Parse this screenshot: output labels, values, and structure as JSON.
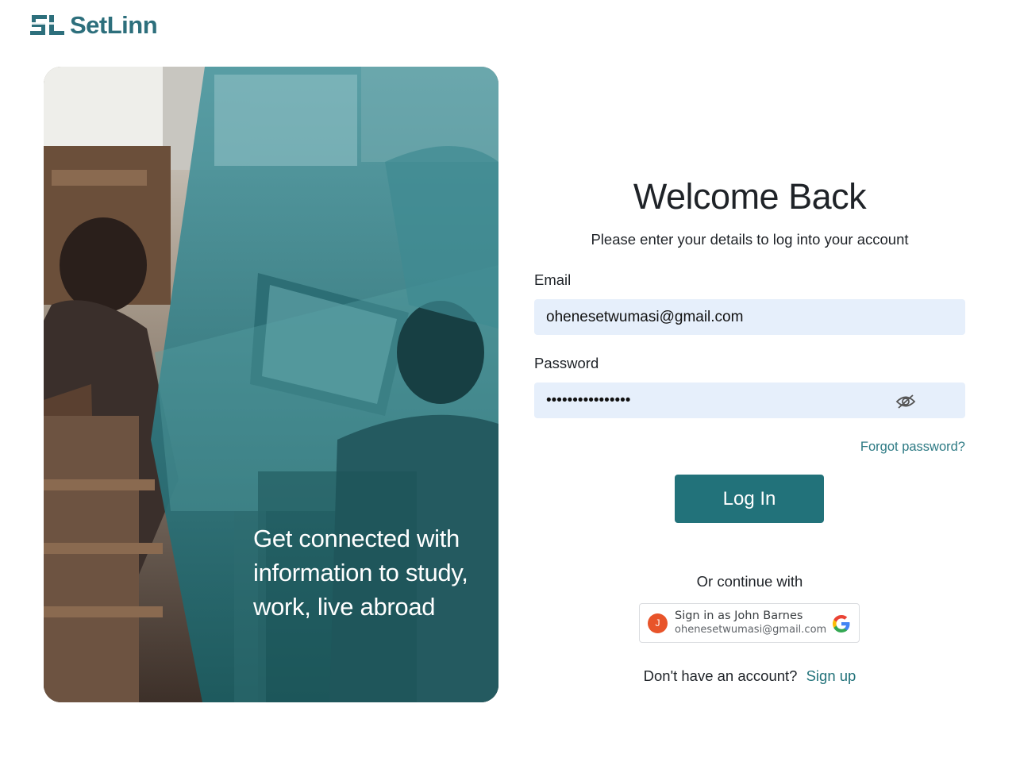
{
  "brand": {
    "name": "SetLinn",
    "color": "#2d6f7c"
  },
  "hero": {
    "caption": "Get connected with information to study, work, live abroad"
  },
  "form": {
    "title": "Welcome Back",
    "subtitle": "Please enter your details to log into your account",
    "email_label": "Email",
    "email_value": "ohenesetwumasi@gmail.com",
    "password_label": "Password",
    "password_value": "••••••••••••••••",
    "forgot_label": "Forgot password?",
    "login_label": "Log In",
    "or_label": "Or continue with",
    "google": {
      "avatar_initial": "J",
      "name_label": "Sign in as John Barnes",
      "email": "ohenesetwumasi@gmail.com"
    },
    "no_account_label": "Don't have an account?",
    "signup_label": "Sign up"
  },
  "colors": {
    "accent": "#22727a",
    "input_bg": "#e6effb",
    "link": "#2d7a84"
  }
}
